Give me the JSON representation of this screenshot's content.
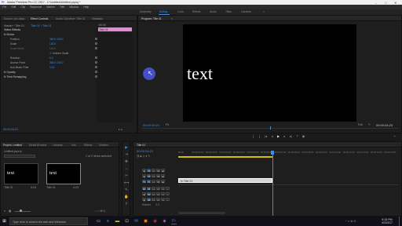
{
  "app": {
    "title": "Adobe Premiere Pro CC 2017 - C:\\Untitled\\Untitled.prproj *",
    "window_controls": [
      "–",
      "□",
      "✕"
    ]
  },
  "menu": [
    "File",
    "Edit",
    "Clip",
    "Sequence",
    "Marker",
    "Title",
    "Window",
    "Help"
  ],
  "workspaces": {
    "tabs": [
      "Assembly",
      "Editing",
      "Color",
      "Effects",
      "Audio",
      "Titles",
      "Libraries"
    ],
    "active_index": 1
  },
  "effect_panel": {
    "tabs": [
      "Source: (no clips)",
      "Effect Controls",
      "Audio Clip Mixer: Title 01",
      "Metadata"
    ],
    "active_index": 1,
    "source": "Master * Title 01",
    "clip": "Title 01 * Title 01",
    "section_header": "Video Effects",
    "mini_time": ":00:00",
    "mini_clip": "Title 01",
    "rows": [
      {
        "label": "fx  Motion",
        "value": ""
      },
      {
        "label": "Position",
        "value": "360.0    240.0"
      },
      {
        "label": "Scale",
        "value": "100.0"
      },
      {
        "label": "Scale Width",
        "value": "100.0"
      },
      {
        "label": "",
        "value": "✓ Uniform Scale"
      },
      {
        "label": "Rotation",
        "value": "0.0"
      },
      {
        "label": "Anchor Point",
        "value": "360.0    240.0"
      },
      {
        "label": "Anti-flicker Filter",
        "value": "0.00"
      },
      {
        "label": "fx  Opacity",
        "value": ""
      },
      {
        "label": "fx  Time Remapping",
        "value": ""
      }
    ],
    "timecode": "00:00:04:21"
  },
  "program": {
    "title": "Program: Title 01",
    "overlay_text": "text",
    "timecode": "00:00:04:21",
    "fit": "Fit",
    "quality": "Full",
    "duration": "00:00:04:23"
  },
  "project": {
    "tabs": [
      "Project: Untitled",
      "Media Browser",
      "Libraries",
      "Info",
      "Effects",
      "Markers",
      "History"
    ],
    "active_index": 0,
    "path": "Untitled.prproj",
    "items_count": "1 of 2 items selected",
    "items": [
      {
        "label": "text",
        "name": "Title 01",
        "duration": "4:23"
      },
      {
        "label": "text",
        "name": "Title 01",
        "duration": "4:23"
      }
    ]
  },
  "tools": [
    "▶",
    "⇥",
    "✥",
    "⇔",
    "✂",
    "⟷",
    "✎",
    "✋",
    "T"
  ],
  "timeline": {
    "tab": "Title 01",
    "timecode": "00:00:04:21",
    "ruler": [
      "00:00",
      "00:00:01:00",
      "00:00:02:00",
      "00:00:03:00",
      "00:00:04:00",
      "00:00:05:00",
      "00:00:06:00",
      "00:00:07:00",
      "00:00:08:00",
      "00:00:09:00",
      "00:00:10:00",
      "00:00:11:00",
      "00:00:12:00",
      "00:00:13:00",
      "00:00:14:00",
      "00:00:15:00"
    ],
    "video_tracks": [
      "V3",
      "V2",
      "V1"
    ],
    "audio_tracks": [
      "A1",
      "A2",
      "A3"
    ],
    "clip_label": "fx  Title 01",
    "master": "Master",
    "master_value": "0.0"
  },
  "taskbar": {
    "search_placeholder": "Type here to search the web and Windows",
    "time": "9:15 PM",
    "date": "4/3/2017"
  },
  "colors": {
    "accent": "#3d8fe6",
    "clip_pink": "#e08ad8",
    "clip_body": "#d4d4d4",
    "playhead": "#3d8fe6"
  }
}
